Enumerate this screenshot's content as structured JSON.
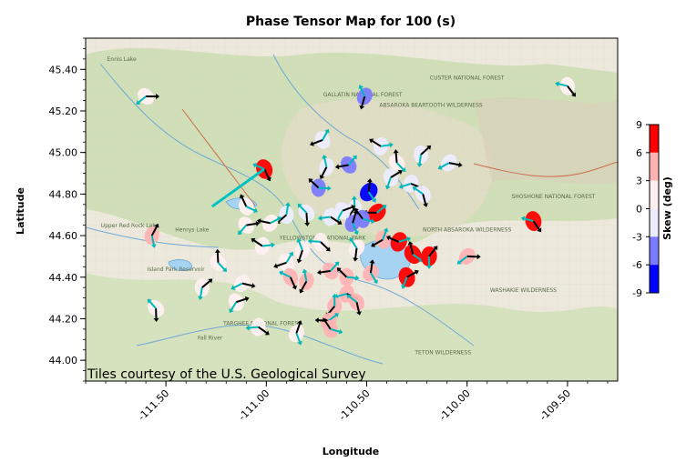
{
  "title": "Phase Tensor Map for 100 (s)",
  "xlabel": "Longitude",
  "ylabel": "Latitude",
  "attribution": "Tiles courtesy of the U.S. Geological Survey",
  "colorbar": {
    "label": "Skew (deg)",
    "ticks": [
      "9",
      "6",
      "3",
      "0",
      "-3",
      "-6",
      "-9"
    ],
    "levels": [
      {
        "range": [
          6,
          9
        ],
        "color": "#ff0000"
      },
      {
        "range": [
          3,
          6
        ],
        "color": "#ffb3b3"
      },
      {
        "range": [
          0,
          3
        ],
        "color": "#fff0f0"
      },
      {
        "range": [
          -3,
          0
        ],
        "color": "#ececff"
      },
      {
        "range": [
          -6,
          -3
        ],
        "color": "#7b7bff"
      },
      {
        "range": [
          -9,
          -6
        ],
        "color": "#0000ff"
      }
    ]
  },
  "map_labels": [
    {
      "text": "GALLATIN NATIONAL FOREST",
      "lon": -110.52,
      "lat": 45.27
    },
    {
      "text": "CUSTER NATIONAL FOREST",
      "lon": -110.0,
      "lat": 45.35
    },
    {
      "text": "ABSAROKA BEARTOOTH WILDERNESS",
      "lon": -110.18,
      "lat": 45.22
    },
    {
      "text": "YELLOWSTONE NATIONAL PARK",
      "lon": -110.72,
      "lat": 44.58
    },
    {
      "text": "NORTH ABSAROKA WILDERNESS",
      "lon": -110.0,
      "lat": 44.62
    },
    {
      "text": "SHOSHONE NATIONAL FOREST",
      "lon": -109.57,
      "lat": 44.78
    },
    {
      "text": "WASHAKIE WILDERNESS",
      "lon": -109.72,
      "lat": 44.33
    },
    {
      "text": "TARGHEE NATIONAL FOREST",
      "lon": -111.02,
      "lat": 44.17
    },
    {
      "text": "TETON WILDERNESS",
      "lon": -110.12,
      "lat": 44.03
    },
    {
      "text": "Upper Red Rock Lake",
      "lon": -111.68,
      "lat": 44.64
    },
    {
      "text": "Island Park Reservoir",
      "lon": -111.45,
      "lat": 44.43
    },
    {
      "text": "Henrys Lake",
      "lon": -111.37,
      "lat": 44.62
    },
    {
      "text": "Ennis Lake",
      "lon": -111.72,
      "lat": 45.44
    },
    {
      "text": "Fall River",
      "lon": -111.28,
      "lat": 44.1
    }
  ],
  "chart_data": {
    "type": "scatter",
    "title": "Phase Tensor Map for 100 (s)",
    "xlabel": "Longitude",
    "ylabel": "Latitude",
    "xlim": [
      -111.9,
      -109.25
    ],
    "ylim": [
      43.9,
      45.55
    ],
    "xticks": [
      "-111.50",
      "-111.00",
      "-110.50",
      "-110.00",
      "-109.50"
    ],
    "xtick_values": [
      -111.5,
      -111.0,
      -110.5,
      -110.0,
      -109.5
    ],
    "yticks": [
      "44.00",
      "44.20",
      "44.40",
      "44.60",
      "44.80",
      "45.00",
      "45.20",
      "45.40"
    ],
    "ytick_values": [
      44.0,
      44.2,
      44.4,
      44.6,
      44.8,
      45.0,
      45.2,
      45.4
    ],
    "stations": [
      {
        "lon": -111.6,
        "lat": 45.27,
        "skew": 0
      },
      {
        "lon": -109.5,
        "lat": 45.32,
        "skew": 0
      },
      {
        "lon": -110.51,
        "lat": 45.27,
        "skew": -4
      },
      {
        "lon": -110.72,
        "lat": 45.06,
        "skew": -1
      },
      {
        "lon": -110.43,
        "lat": 45.03,
        "skew": -1
      },
      {
        "lon": -110.35,
        "lat": 44.95,
        "skew": 1
      },
      {
        "lon": -110.23,
        "lat": 44.99,
        "skew": -2
      },
      {
        "lon": -110.09,
        "lat": 44.95,
        "skew": -1
      },
      {
        "lon": -111.01,
        "lat": 44.92,
        "skew": 8
      },
      {
        "lon": -110.7,
        "lat": 44.93,
        "skew": -2
      },
      {
        "lon": -110.59,
        "lat": 44.94,
        "skew": -5
      },
      {
        "lon": -110.74,
        "lat": 44.83,
        "skew": -5
      },
      {
        "lon": -110.49,
        "lat": 44.81,
        "skew": -8
      },
      {
        "lon": -110.38,
        "lat": 44.88,
        "skew": -1
      },
      {
        "lon": -110.28,
        "lat": 44.85,
        "skew": -1
      },
      {
        "lon": -110.22,
        "lat": 44.8,
        "skew": -1
      },
      {
        "lon": -110.56,
        "lat": 44.73,
        "skew": -3
      },
      {
        "lon": -110.45,
        "lat": 44.71,
        "skew": 8
      },
      {
        "lon": -110.52,
        "lat": 44.68,
        "skew": -5
      },
      {
        "lon": -110.57,
        "lat": 44.66,
        "skew": -4
      },
      {
        "lon": -110.62,
        "lat": 44.72,
        "skew": -1
      },
      {
        "lon": -110.68,
        "lat": 44.69,
        "skew": -1
      },
      {
        "lon": -110.8,
        "lat": 44.71,
        "skew": -1
      },
      {
        "lon": -110.9,
        "lat": 44.7,
        "skew": -1
      },
      {
        "lon": -110.98,
        "lat": 44.66,
        "skew": 1
      },
      {
        "lon": -111.1,
        "lat": 44.74,
        "skew": 0
      },
      {
        "lon": -111.57,
        "lat": 44.6,
        "skew": 5
      },
      {
        "lon": -111.1,
        "lat": 44.65,
        "skew": 1
      },
      {
        "lon": -110.73,
        "lat": 44.57,
        "skew": 1
      },
      {
        "lon": -110.55,
        "lat": 44.54,
        "skew": 1
      },
      {
        "lon": -110.42,
        "lat": 44.58,
        "skew": 5
      },
      {
        "lon": -110.34,
        "lat": 44.57,
        "skew": 8
      },
      {
        "lon": -110.27,
        "lat": 44.51,
        "skew": 8
      },
      {
        "lon": -110.19,
        "lat": 44.5,
        "skew": 8
      },
      {
        "lon": -110.0,
        "lat": 44.5,
        "skew": 5
      },
      {
        "lon": -109.67,
        "lat": 44.67,
        "skew": 8
      },
      {
        "lon": -110.82,
        "lat": 44.53,
        "skew": 2
      },
      {
        "lon": -110.9,
        "lat": 44.47,
        "skew": 2
      },
      {
        "lon": -111.02,
        "lat": 44.55,
        "skew": 0
      },
      {
        "lon": -111.24,
        "lat": 44.47,
        "skew": 0
      },
      {
        "lon": -111.32,
        "lat": 44.35,
        "skew": 0
      },
      {
        "lon": -111.12,
        "lat": 44.37,
        "skew": 0
      },
      {
        "lon": -110.88,
        "lat": 44.4,
        "skew": 3
      },
      {
        "lon": -110.8,
        "lat": 44.38,
        "skew": 3
      },
      {
        "lon": -110.68,
        "lat": 44.43,
        "skew": 3
      },
      {
        "lon": -110.6,
        "lat": 44.4,
        "skew": 3
      },
      {
        "lon": -110.48,
        "lat": 44.42,
        "skew": 5
      },
      {
        "lon": -110.3,
        "lat": 44.4,
        "skew": 8
      },
      {
        "lon": -110.6,
        "lat": 44.32,
        "skew": 3
      },
      {
        "lon": -110.55,
        "lat": 44.28,
        "skew": 4
      },
      {
        "lon": -110.66,
        "lat": 44.26,
        "skew": 3
      },
      {
        "lon": -110.69,
        "lat": 44.19,
        "skew": 5
      },
      {
        "lon": -110.68,
        "lat": 44.15,
        "skew": 5
      },
      {
        "lon": -110.85,
        "lat": 44.13,
        "skew": 2
      },
      {
        "lon": -111.15,
        "lat": 44.28,
        "skew": 0
      },
      {
        "lon": -111.04,
        "lat": 44.16,
        "skew": 0
      },
      {
        "lon": -111.55,
        "lat": 44.25,
        "skew": 0
      }
    ]
  }
}
